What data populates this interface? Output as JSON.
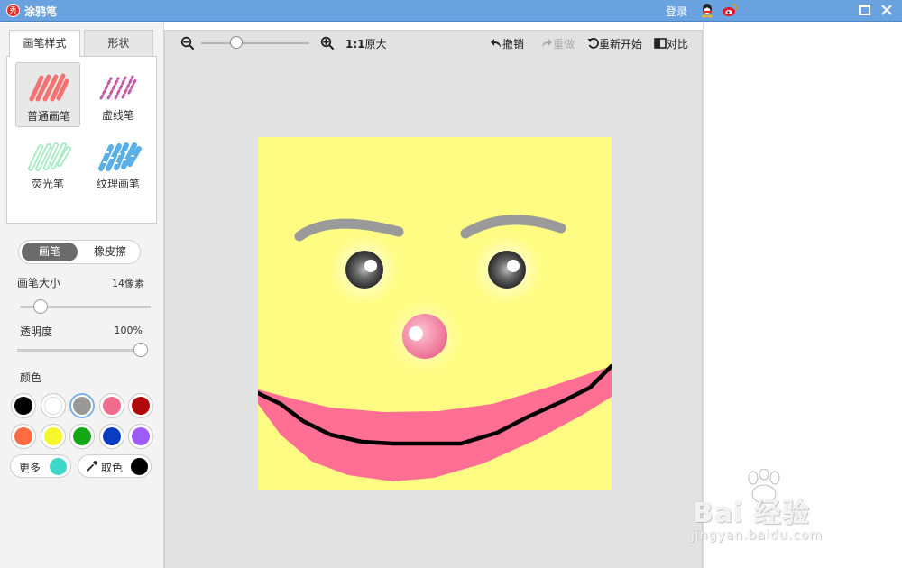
{
  "window": {
    "title": "涂鸦笔",
    "logo_text": "秀",
    "login_label": "登录",
    "icons": [
      "qq-icon",
      "weibo-icon",
      "maximize-icon",
      "close-icon"
    ]
  },
  "left_panel": {
    "tabs": [
      {
        "label": "画笔样式",
        "active": true
      },
      {
        "label": "形状",
        "active": false
      }
    ],
    "brushes": [
      {
        "label": "普通画笔",
        "selected": true,
        "color": "#f07070"
      },
      {
        "label": "虚线笔",
        "selected": false,
        "color": "#c05aa8"
      },
      {
        "label": "荧光笔",
        "selected": false,
        "color": "#9de6b4"
      },
      {
        "label": "纹理画笔",
        "selected": false,
        "color": "#5aaee6"
      }
    ],
    "mode_toggle": {
      "pen_label": "画笔",
      "eraser_label": "橡皮擦",
      "active": "画笔"
    },
    "brush_size": {
      "label": "画笔大小",
      "value_text": "14像素",
      "fraction": 0.12
    },
    "opacity": {
      "label": "透明度",
      "value_text": "100%",
      "fraction": 1.0
    },
    "color_label": "颜色",
    "palette": [
      "#000000",
      "#ffffff",
      "#999999",
      "#f06a8e",
      "#b00808",
      "#ff6b40",
      "#f6f62a",
      "#13a813",
      "#0a3cc2",
      "#9e5cf6"
    ],
    "selected_color": "#999999",
    "more": {
      "label": "更多",
      "color": "#3ed8c8"
    },
    "picker": {
      "label": "取色",
      "color": "#000000"
    }
  },
  "toolbar": {
    "zoom_fraction": 0.3,
    "ratio_label": "1:1",
    "original_label": "原大",
    "undo_label": "撤销",
    "redo_label": "重做",
    "restart_label": "重新开始",
    "compare_label": "对比",
    "redo_enabled": false
  },
  "canvas": {
    "background_color": "#fffc84",
    "eyebrow_color": "#9a9a9a",
    "eye_color": "#3a3a3a",
    "nose_color": "#f38aa6",
    "mouth_color": "#ff6f93",
    "line_color": "#000000"
  },
  "watermark": {
    "main": "Bai 经验",
    "sub": "jingyan.baidu.com"
  }
}
